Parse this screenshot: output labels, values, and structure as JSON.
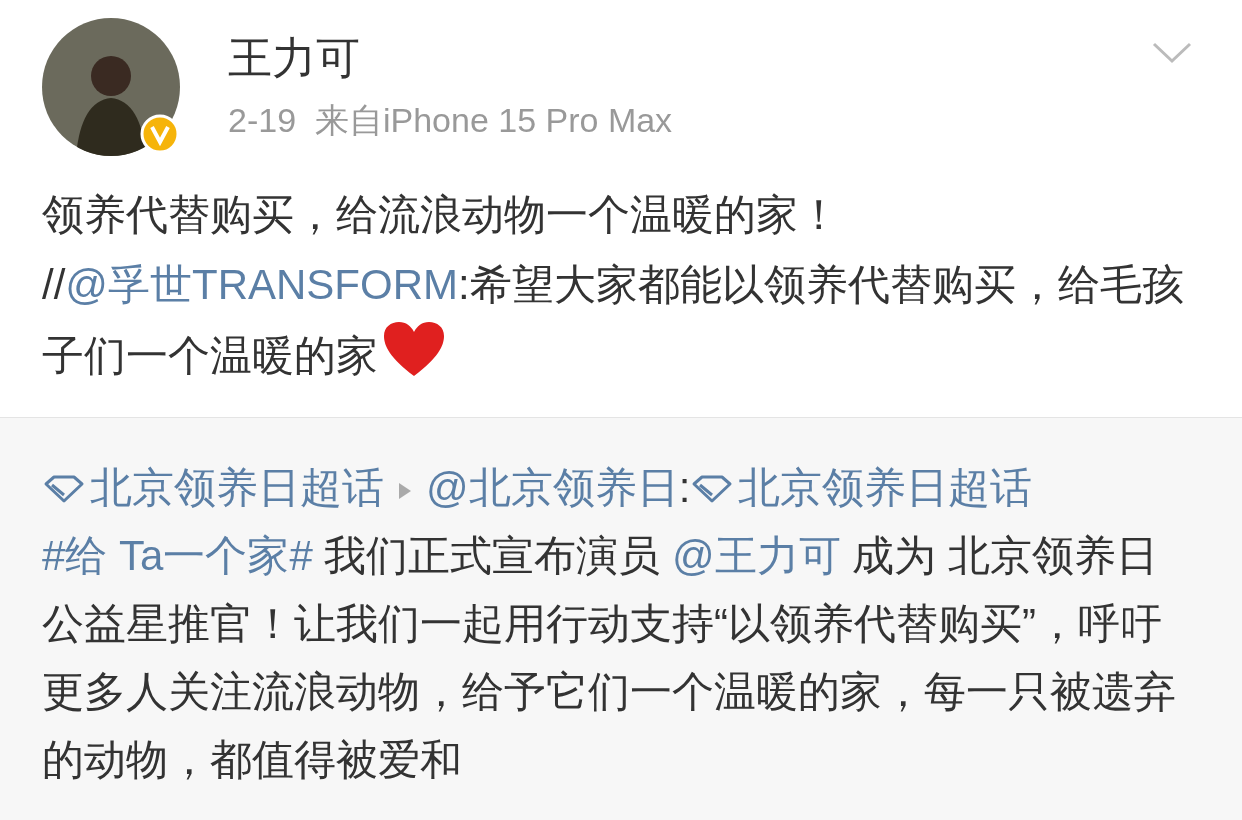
{
  "post": {
    "author": "王力可",
    "verified": true,
    "meta": "2-19  来自iPhone 15 Pro Max",
    "text": [
      {
        "kind": "text",
        "text": "领养代替购买，给流浪动物一个温暖的家！ //"
      },
      {
        "kind": "mention",
        "text": "@孚世TRANSFORM"
      },
      {
        "kind": "text",
        "text": ":希望大家都能以领养代替购买，给毛孩子们一个温暖的家"
      },
      {
        "kind": "heart"
      }
    ]
  },
  "repost": {
    "text": [
      {
        "kind": "topic",
        "text": "北京领养日超话"
      },
      {
        "kind": "arrow"
      },
      {
        "kind": "mention",
        "text": "@北京领养日"
      },
      {
        "kind": "text",
        "text": ":"
      },
      {
        "kind": "topic",
        "text": "北京领养日超话"
      },
      {
        "kind": "mention",
        "text": "#给 Ta一个家#"
      },
      {
        "kind": "text",
        "text": " 我们正式宣布演员 "
      },
      {
        "kind": "mention",
        "text": "@王力可"
      },
      {
        "kind": "text",
        "text": " 成为 北京领养日公益星推官！让我们一起用行动支持“以领养代替购买”，呼吁更多人关注流浪动物，给予它们一个温暖的家，每一只被遗弃的动物，都值得被爱和"
      }
    ]
  }
}
